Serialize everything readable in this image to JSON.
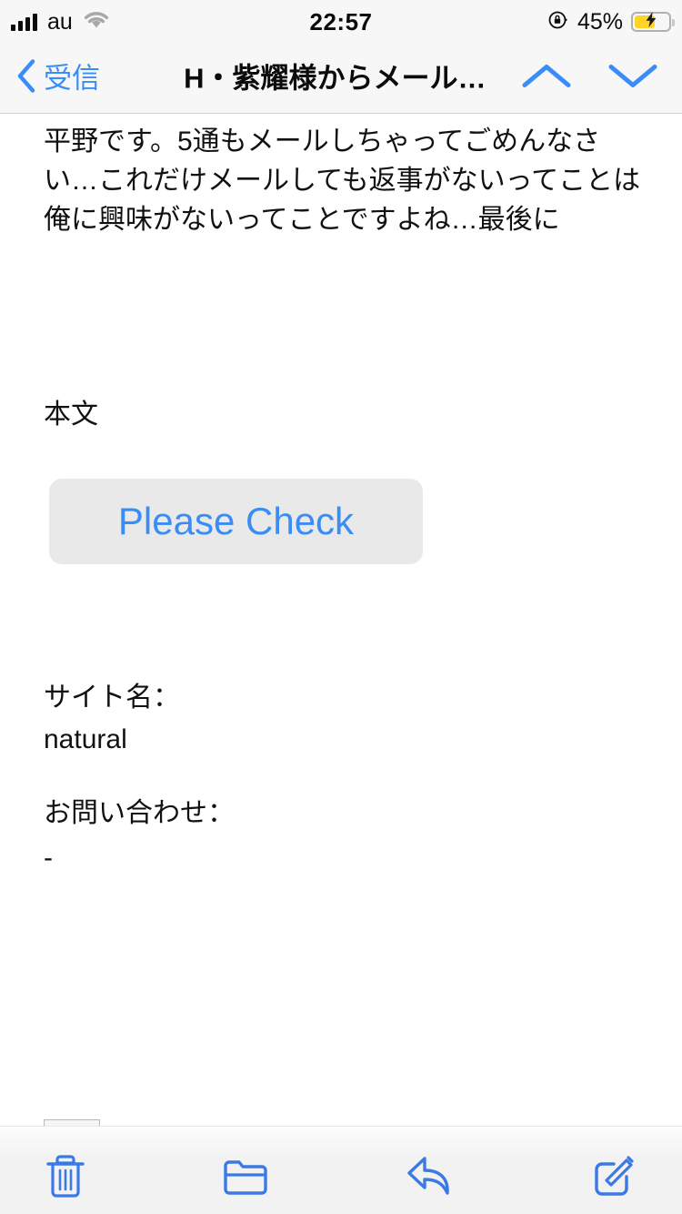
{
  "status_bar": {
    "carrier": "au",
    "time": "22:57",
    "battery_percent": "45%",
    "signal_bars": 4,
    "wifi_icon": "wifi-icon",
    "rotation_lock_icon": "rotation-lock-icon",
    "battery_icon": "battery-charging-icon",
    "battery_fill_color": "#ffd426"
  },
  "nav_bar": {
    "back_label": "受信",
    "back_icon": "chevron-left-icon",
    "title": "H・紫耀様からメール…",
    "prev_message_icon": "chevron-up-icon",
    "next_message_icon": "chevron-down-icon",
    "accent_color": "#3a8cf7"
  },
  "message": {
    "body_text": "平野です。5通もメールしちゃってごめんなさい…これだけメールしても返事がないってことは俺に興味がないってことですよね…最後に",
    "honbun_label": "本文",
    "check_button_label": "Please Check",
    "site_label": "サイト名：",
    "site_value": "natural",
    "contact_label": "お問い合わせ：",
    "contact_value": "-",
    "image_placeholder_alt": "img"
  },
  "toolbar": {
    "trash_icon": "trash-icon",
    "folder_icon": "folder-icon",
    "reply_icon": "reply-arrow-icon",
    "compose_icon": "compose-icon",
    "icon_color": "#3a79e6"
  }
}
